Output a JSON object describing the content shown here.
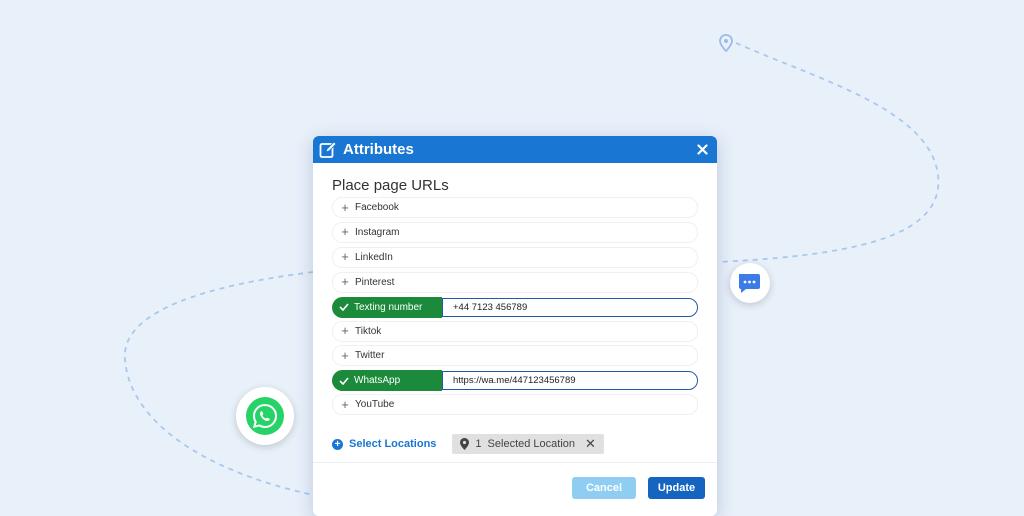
{
  "colors": {
    "header": "#1976d2",
    "active_green": "#1b8a3a",
    "input_border": "#1e5aa8",
    "whatsapp_green": "#25d366",
    "chat_blue": "#3d7be6",
    "background": "#e8f0fa"
  },
  "decor": {
    "pin_icon": "map-pin-icon",
    "chat_icon": "chat-bubble-icon",
    "whatsapp_icon": "whatsapp-logo-icon"
  },
  "modal": {
    "title": "Attributes",
    "title_icon": "edit-icon",
    "close_icon": "close-icon",
    "section_title": "Place page URLs",
    "rows": [
      {
        "label": "Facebook",
        "active": false
      },
      {
        "label": "Instagram",
        "active": false
      },
      {
        "label": "LinkedIn",
        "active": false
      },
      {
        "label": "Pinterest",
        "active": false
      },
      {
        "label": "Texting number",
        "active": true,
        "value": "+44 7123 456789"
      },
      {
        "label": "Tiktok",
        "active": false
      },
      {
        "label": "Twitter",
        "active": false
      },
      {
        "label": "WhatsApp",
        "active": true,
        "value": "https://wa.me/447123456789"
      },
      {
        "label": "YouTube",
        "active": false
      }
    ],
    "select_locations_label": "Select Locations",
    "selected_count": "1",
    "selected_label": "Selected Location",
    "cancel_label": "Cancel",
    "update_label": "Update"
  }
}
